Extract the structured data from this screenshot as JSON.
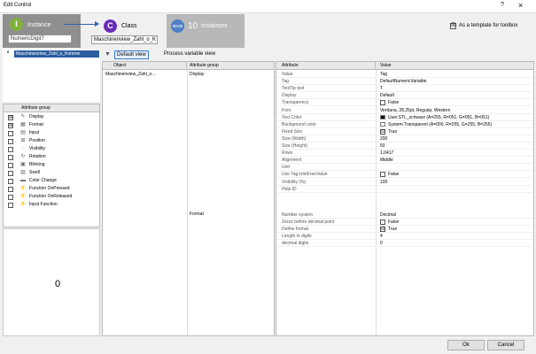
{
  "window": {
    "title": "Edit Control",
    "help": "?",
    "close": "×"
  },
  "header": {
    "instance_label": "Instance",
    "instance_value": "NumericDigit7",
    "class_label": "Class",
    "class_value": "Maschinenview_Zahl_o_K",
    "instances_count": "10",
    "instances_label": "instances",
    "template_checked": "☒",
    "template_label": "As a template for toolbox"
  },
  "tree": {
    "item": "Maschinenview_Zahl_o_Komme"
  },
  "attribute_groups": {
    "header": "Attribute group",
    "items": [
      {
        "label": "Display",
        "checked": "☒"
      },
      {
        "label": "Format",
        "checked": "☒"
      },
      {
        "label": "Input",
        "checked": ""
      },
      {
        "label": "Position",
        "checked": ""
      },
      {
        "label": "Visibility",
        "checked": ""
      },
      {
        "label": "Rotation",
        "checked": ""
      },
      {
        "label": "Blinking",
        "checked": ""
      },
      {
        "label": "Swell",
        "checked": ""
      },
      {
        "label": "Color Change",
        "checked": ""
      },
      {
        "label": "Function OnPressed",
        "checked": ""
      },
      {
        "label": "Function OnReleased",
        "checked": ""
      },
      {
        "label": "Input Function",
        "checked": ""
      }
    ]
  },
  "zero_panel": {
    "value": "0"
  },
  "toolbar": {
    "default_view": "Default view",
    "process_view": "Process variable view"
  },
  "left_grid": {
    "col_object": "Object",
    "col_group": "Attribute group",
    "object_row": "Maschinenview_Zahl_o...",
    "group_display": "Display",
    "group_format": "Format"
  },
  "right_grid": {
    "col_attribute": "Attribute",
    "col_value": "Value",
    "display_rows": [
      {
        "attr": "Value",
        "value": "Tag"
      },
      {
        "attr": "Tag",
        "value": "DefaultNumericVariable"
      },
      {
        "attr": "ToolTip text",
        "value": "T"
      },
      {
        "attr": "Display",
        "value": "Default"
      },
      {
        "attr": "Transparency",
        "cb": "",
        "value": "False"
      },
      {
        "attr": "Font",
        "value": "Verdana, 28,25pt, Regular, Western"
      },
      {
        "attr": "Text Color",
        "sw": "#101010",
        "value": "User.STL_schwarz (A=255, R=051, G=051, B=051)"
      },
      {
        "attr": "Background color",
        "sw": "#ffffff",
        "value": "System.Transparent (A=000, R=255, G=255, B=255)"
      },
      {
        "attr": "Fixed Size",
        "cb": "☑",
        "value": "True"
      },
      {
        "attr": "Size (Width)",
        "value": "200"
      },
      {
        "attr": "Size (Height)",
        "value": "50"
      },
      {
        "attr": "Rows",
        "value": "1,0417"
      },
      {
        "attr": "Alignment",
        "value": "Middle"
      },
      {
        "attr": "Unit",
        "value": ""
      },
      {
        "attr": "Use Tag-UnitFreeValue",
        "cb": "",
        "value": "False"
      },
      {
        "attr": "Visibility (%)",
        "value": "100"
      },
      {
        "attr": "Help ID",
        "value": ""
      }
    ],
    "format_rows": [
      {
        "attr": "Number system",
        "value": "Decimal"
      },
      {
        "attr": "Zeros before decimal point",
        "cb": "",
        "value": "False"
      },
      {
        "attr": "Define format",
        "cb": "☑",
        "value": "True"
      },
      {
        "attr": "Length in digits",
        "value": "4"
      },
      {
        "attr": "decimal digits",
        "value": "0"
      }
    ]
  },
  "footer": {
    "ok": "Ok",
    "cancel": "Cancel"
  },
  "icons": {
    "display": "display-icon",
    "format": "format-icon",
    "input": "input-icon",
    "position": "position-icon",
    "visibility": "visibility-icon",
    "rotation": "rotation-icon",
    "blinking": "blinking-icon",
    "swell": "swell-icon",
    "color_change": "color-change-icon",
    "function": "lightning-icon"
  },
  "colors": {
    "instance": "#7fb13a",
    "class": "#6a2ab8",
    "instances": "#4f7fc4",
    "selection": "#2c5d9e"
  }
}
